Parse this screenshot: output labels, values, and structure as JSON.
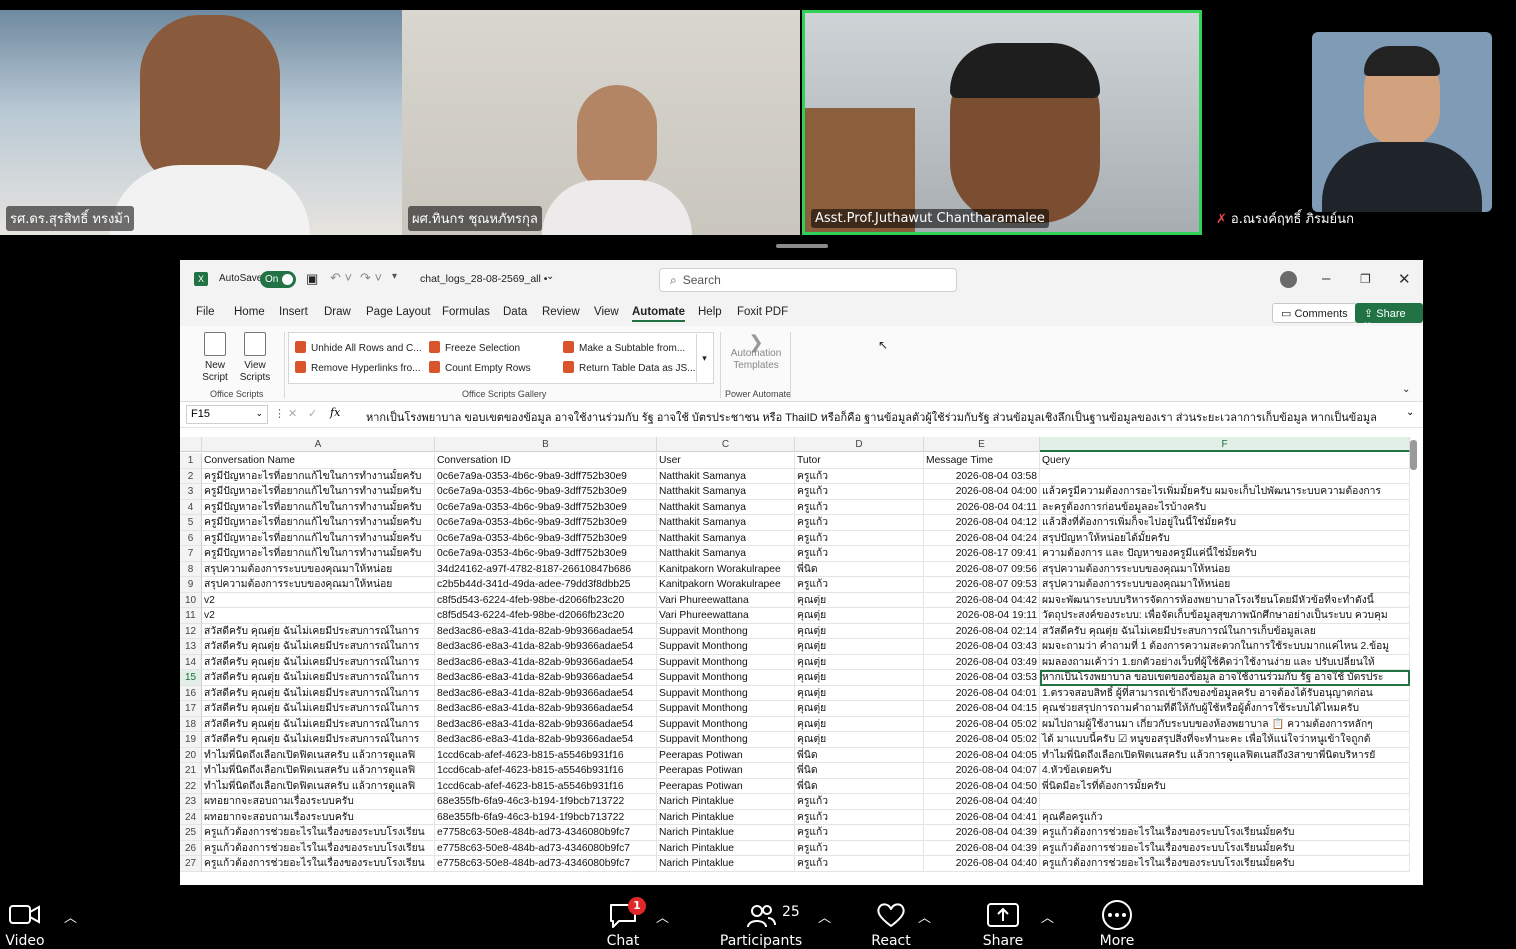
{
  "participants": [
    {
      "name": "รศ.ดร.สุรสิทธิ์ ทรงม้า",
      "muted": false,
      "active": false
    },
    {
      "name": "ผศ.ทินกร ชุณหภัทรกุล",
      "muted": false,
      "active": false
    },
    {
      "name": "Asst.Prof.Juthawut Chantharamalee",
      "muted": false,
      "active": true
    },
    {
      "name": "อ.ณรงค์ฤทธิ์ ภิรมย์นก",
      "muted": true,
      "active": false
    }
  ],
  "excel": {
    "autosave_label": "AutoSave",
    "autosave_state": "On",
    "filename": "chat_logs_28-08-2569_all •",
    "search_placeholder": "Search",
    "menu_tabs": [
      "File",
      "Home",
      "Insert",
      "Draw",
      "Page Layout",
      "Formulas",
      "Data",
      "Review",
      "View",
      "Automate",
      "Help",
      "Foxit PDF"
    ],
    "active_tab": "Automate",
    "comments_label": "Comments",
    "share_label": "Share",
    "ribbon": {
      "new_script": "New Script",
      "view_scripts": "View Scripts",
      "office_scripts_label": "Office Scripts",
      "gallery": [
        "Unhide All Rows and C...",
        "Remove Hyperlinks fro...",
        "Freeze Selection",
        "Count Empty Rows",
        "Make a Subtable from...",
        "Return Table Data as JS..."
      ],
      "gallery_label": "Office Scripts Gallery",
      "automation_templates": "Automation Templates",
      "power_automate_label": "Power Automate"
    },
    "name_box": "F15",
    "formula": "หากเป็นโรงพยาบาล ขอบเขตของข้อมูล อาจใช้งานร่วมกับ รัฐ อาจใช้ บัตรประชาชน หรือ ThaiID หรือก็คือ ฐานข้อมูลตัวผู้ใช้ร่วมกับรัฐ ส่วนข้อมูลเชิงลึกเป็นฐานข้อมูลของเรา ส่วนระยะเวลาการเก็บข้อมูล หากเป็นข้อมูล",
    "columns": [
      "A",
      "B",
      "C",
      "D",
      "E",
      "F"
    ],
    "header_row": [
      "Conversation Name",
      "Conversation ID",
      "User",
      "Tutor",
      "Message Time",
      "Query"
    ],
    "rows": [
      [
        "ครูมีปัญหาอะไรที่อยากแก้ไขในการทำงานมั้ยครับ",
        "0c6e7a9a-0353-4b6c-9ba9-3dff752b30e9",
        "Natthakit Samanya",
        "ครูแก้ว",
        "2026-08-04 03:58",
        ""
      ],
      [
        "ครูมีปัญหาอะไรที่อยากแก้ไขในการทำงานมั้ยครับ",
        "0c6e7a9a-0353-4b6c-9ba9-3dff752b30e9",
        "Natthakit Samanya",
        "ครูแก้ว",
        "2026-08-04 04:00",
        "แล้วครูมีความต้องการอะไรเพิ่มมั้ยครับ ผมจะเก็บไปพัฒนาระบบความต้องการ"
      ],
      [
        "ครูมีปัญหาอะไรที่อยากแก้ไขในการทำงานมั้ยครับ",
        "0c6e7a9a-0353-4b6c-9ba9-3dff752b30e9",
        "Natthakit Samanya",
        "ครูแก้ว",
        "2026-08-04 04:11",
        "ละครูต้องการก่อนข้อมูลอะไรบ้างครับ"
      ],
      [
        "ครูมีปัญหาอะไรที่อยากแก้ไขในการทำงานมั้ยครับ",
        "0c6e7a9a-0353-4b6c-9ba9-3dff752b30e9",
        "Natthakit Samanya",
        "ครูแก้ว",
        "2026-08-04 04:12",
        "แล้วสิ่งที่ต้องการเพิ่มก็จะไปอยู่ในนี้ใช่มั้ยครับ"
      ],
      [
        "ครูมีปัญหาอะไรที่อยากแก้ไขในการทำงานมั้ยครับ",
        "0c6e7a9a-0353-4b6c-9ba9-3dff752b30e9",
        "Natthakit Samanya",
        "ครูแก้ว",
        "2026-08-04 04:24",
        "สรุปปัญหาให้หน่อยได้มั้ยครับ"
      ],
      [
        "ครูมีปัญหาอะไรที่อยากแก้ไขในการทำงานมั้ยครับ",
        "0c6e7a9a-0353-4b6c-9ba9-3dff752b30e9",
        "Natthakit Samanya",
        "ครูแก้ว",
        "2026-08-17 09:41",
        "ความต้องการ และ ปัญหาของครูมีแค่นี้ใช่มั้ยครับ"
      ],
      [
        "สรุปความต้องการระบบของคุณมาให้หน่อย",
        "34d24162-a97f-4782-8187-26610847b686",
        "Kanitpakorn Worakulrapee",
        "พี่นิด",
        "2026-08-07 09:56",
        "สรุปความต้องการระบบของคุณมาให้หน่อย"
      ],
      [
        "สรุปความต้องการระบบของคุณมาให้หน่อย",
        "c2b5b44d-341d-49da-adee-79dd3f8dbb25",
        "Kanitpakorn Worakulrapee",
        "ครูแก้ว",
        "2026-08-07 09:53",
        "สรุปความต้องการระบบของคุณมาให้หน่อย"
      ],
      [
        "v2",
        "c8f5d543-6224-4feb-98be-d2066fb23c20",
        "Vari Phureewattana",
        "คุณตุ่ย",
        "2026-08-04 04:42",
        "ผมจะพัฒนาระบบบริหารจัดการห้องพยาบาลโรงเรียนโดยมีหัวข้อที่จะทำดังนี้"
      ],
      [
        "v2",
        "c8f5d543-6224-4feb-98be-d2066fb23c20",
        "Vari Phureewattana",
        "คุณตุ่ย",
        "2026-08-04 19:11",
        "วัตถุประสงค์ของระบบ: เพื่อจัดเก็บข้อมูลสุขภาพนักศึกษาอย่างเป็นระบบ ควบคุม"
      ],
      [
        "สวัสดีครับ คุณตุ่ย ฉันไม่เคยมีประสบการณ์ในการ",
        "8ed3ac86-e8a3-41da-82ab-9b9366adae54",
        "Suppavit Monthong",
        "คุณตุ่ย",
        "2026-08-04 02:14",
        "สวัสดีครับ คุณตุ่ย ฉันไม่เคยมีประสบการณ์ในการเก็บข้อมูลเลย"
      ],
      [
        "สวัสดีครับ คุณตุ่ย ฉันไม่เคยมีประสบการณ์ในการ",
        "8ed3ac86-e8a3-41da-82ab-9b9366adae54",
        "Suppavit Monthong",
        "คุณตุ่ย",
        "2026-08-04 03:43",
        "ผมจะถามว่า คำถามที่ 1 ต้องการความสะดวกในการใช้ระบบมากแค่ไหน 2.ข้อมู"
      ],
      [
        "สวัสดีครับ คุณตุ่ย ฉันไม่เคยมีประสบการณ์ในการ",
        "8ed3ac86-e8a3-41da-82ab-9b9366adae54",
        "Suppavit Monthong",
        "คุณตุ่ย",
        "2026-08-04 03:49",
        "ผมลองถามเค้าว่า 1.ยกตัวอย่างเว็บที่ผู้ใช้คิดว่าใช้งานง่าย และ ปรับเปลี่ยนให้"
      ],
      [
        "สวัสดีครับ คุณตุ่ย ฉันไม่เคยมีประสบการณ์ในการ",
        "8ed3ac86-e8a3-41da-82ab-9b9366adae54",
        "Suppavit Monthong",
        "คุณตุ่ย",
        "2026-08-04 03:53",
        "หากเป็นโรงพยาบาล ขอบเขตของข้อมูล อาจใช้งานร่วมกับ รัฐ อาจใช้ บัตรประ"
      ],
      [
        "สวัสดีครับ คุณตุ่ย ฉันไม่เคยมีประสบการณ์ในการ",
        "8ed3ac86-e8a3-41da-82ab-9b9366adae54",
        "Suppavit Monthong",
        "คุณตุ่ย",
        "2026-08-04 04:01",
        "1.ตรวจสอบสิทธิ์ ผู้ที่สามารถเข้าถึงของข้อมูลครับ อาจต้องได้รับอนุญาตก่อน"
      ],
      [
        "สวัสดีครับ คุณตุ่ย ฉันไม่เคยมีประสบการณ์ในการ",
        "8ed3ac86-e8a3-41da-82ab-9b9366adae54",
        "Suppavit Monthong",
        "คุณตุ่ย",
        "2026-08-04 04:15",
        "คุณช่วยสรุปการถามคำถามที่ดีให้กับผู้ใช้หรือผู้ตั้งการใช้ระบบได้ไหมครับ"
      ],
      [
        "สวัสดีครับ คุณตุ่ย ฉันไม่เคยมีประสบการณ์ในการ",
        "8ed3ac86-e8a3-41da-82ab-9b9366adae54",
        "Suppavit Monthong",
        "คุณตุ่ย",
        "2026-08-04 05:02",
        "ผมไปถามผู้ใช้งานมา เกี่ยวกับระบบของห้องพยาบาล 📋 ความต้องการหลักๆ"
      ],
      [
        "สวัสดีครับ คุณตุ่ย ฉันไม่เคยมีประสบการณ์ในการ",
        "8ed3ac86-e8a3-41da-82ab-9b9366adae54",
        "Suppavit Monthong",
        "คุณตุ่ย",
        "2026-08-04 05:02",
        "ได้ มาแบบนี้ครับ ☑ หนูขอสรุปสิ่งที่จะทำนะคะ เพื่อให้แน่ใจว่าหนูเข้าใจถูกต้"
      ],
      [
        "ทำไมพี่นิดถึงเลือกเปิดฟิตเนสครับ แล้วการดูแลฟิ",
        "1ccd6cab-afef-4623-b815-a5546b931f16",
        "Peerapas Potiwan",
        "พี่นิด",
        "2026-08-04 04:05",
        "ทำไมพี่นิดถึงเลือกเปิดฟิตเนสครับ แล้วการดูแลฟิตเนสถึง3สาขาพี่นิดบริหารยั"
      ],
      [
        "ทำไมพี่นิดถึงเลือกเปิดฟิตเนสครับ แล้วการดูแลฟิ",
        "1ccd6cab-afef-4623-b815-a5546b931f16",
        "Peerapas Potiwan",
        "พี่นิด",
        "2026-08-04 04:07",
        "4.หัวข้อเดยครับ"
      ],
      [
        "ทำไมพี่นิดถึงเลือกเปิดฟิตเนสครับ แล้วการดูแลฟิ",
        "1ccd6cab-afef-4623-b815-a5546b931f16",
        "Peerapas Potiwan",
        "พี่นิด",
        "2026-08-04 04:50",
        "พี่นิดมีอะไรที่ต้องการมั้ยครับ"
      ],
      [
        "ผทอยากจะสอบถามเรื่องระบบครับ",
        "68e355fb-6fa9-46c3-b194-1f9bcb713722",
        "Narich Pintaklue",
        "ครูแก้ว",
        "2026-08-04 04:40",
        ""
      ],
      [
        "ผทอยากจะสอบถามเรื่องระบบครับ",
        "68e355fb-6fa9-46c3-b194-1f9bcb713722",
        "Narich Pintaklue",
        "ครูแก้ว",
        "2026-08-04 04:41",
        "คุณคือครูแก้ว"
      ],
      [
        "ครูแก้วต้องการช่วยอะไรในเรื่องของระบบโรงเรียน",
        "e7758c63-50e8-484b-ad73-4346080b9fc7",
        "Narich Pintaklue",
        "ครูแก้ว",
        "2026-08-04 04:39",
        "ครูแก้วต้องการช่วยอะไรในเรื่องของระบบโรงเรียนมั้ยครับ"
      ],
      [
        "ครูแก้วต้องการช่วยอะไรในเรื่องของระบบโรงเรียน",
        "e7758c63-50e8-484b-ad73-4346080b9fc7",
        "Narich Pintaklue",
        "ครูแก้ว",
        "2026-08-04 04:39",
        "ครูแก้วต้องการช่วยอะไรในเรื่องของระบบโรงเรียนมั้ยครับ"
      ],
      [
        "ครูแก้วต้องการช่วยอะไรในเรื่องของระบบโรงเรียน",
        "e7758c63-50e8-484b-ad73-4346080b9fc7",
        "Narich Pintaklue",
        "ครูแก้ว",
        "2026-08-04 04:40",
        "ครูแก้วต้องการช่วยอะไรในเรื่องของระบบโรงเรียนมั้ยครับ"
      ]
    ]
  },
  "toolbar": {
    "video_label": "Video",
    "chat_label": "Chat",
    "chat_badge": "1",
    "participants_label": "Participants",
    "participants_count": "25",
    "react_label": "React",
    "share_label": "Share",
    "more_label": "More"
  },
  "colors": {
    "excel_green": "#217346",
    "active_speaker": "#2fd156",
    "badge_red": "#e02828"
  }
}
